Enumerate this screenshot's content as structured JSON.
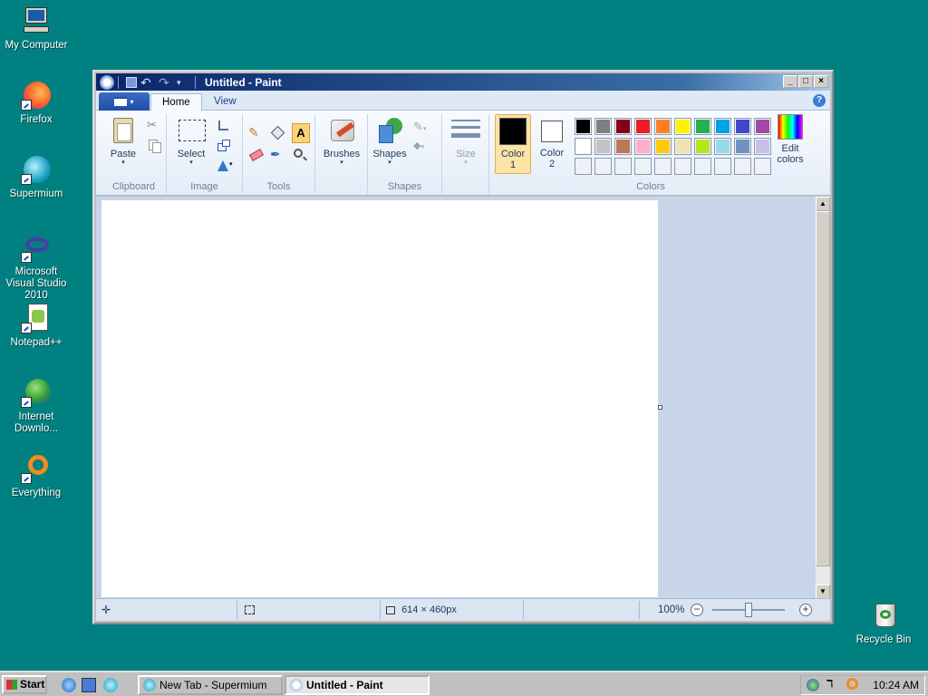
{
  "desktop": {
    "icons": [
      {
        "label": "My Computer"
      },
      {
        "label": "Firefox"
      },
      {
        "label": "Supermium"
      },
      {
        "label": "Microsoft Visual Studio 2010"
      },
      {
        "label": "Notepad++"
      },
      {
        "label": "Internet Downlo..."
      },
      {
        "label": "Everything"
      },
      {
        "label": "Recycle Bin"
      }
    ]
  },
  "window": {
    "title": "Untitled - Paint",
    "controls": {
      "minimize": "_",
      "maximize": "□",
      "close": "×"
    }
  },
  "ribbon": {
    "tabs": [
      {
        "label": "Home",
        "active": true
      },
      {
        "label": "View",
        "active": false
      }
    ],
    "groups": {
      "clipboard": {
        "label": "Clipboard",
        "paste": "Paste"
      },
      "image": {
        "label": "Image",
        "select": "Select"
      },
      "tools": {
        "label": "Tools"
      },
      "brushes": {
        "label": "Brushes"
      },
      "shapes": {
        "label": "Shapes",
        "shapes_btn": "Shapes"
      },
      "size": {
        "label": "Size"
      },
      "colors": {
        "label": "Colors",
        "color1": "Color\n1",
        "color1_a": "Color",
        "color1_b": "1",
        "color2_a": "Color",
        "color2_b": "2",
        "edit_a": "Edit",
        "edit_b": "colors",
        "color1_value": "#000000",
        "color2_value": "#ffffff",
        "palette_row1": [
          "#000000",
          "#7f7f7f",
          "#880015",
          "#ed1c24",
          "#ff7f27",
          "#fff200",
          "#22b14c",
          "#00a2e8",
          "#3f48cc",
          "#a349a4"
        ],
        "palette_row2": [
          "#ffffff",
          "#c3c3c3",
          "#b97a57",
          "#ffaec9",
          "#ffc90e",
          "#efe4b0",
          "#b5e61d",
          "#99d9ea",
          "#7092be",
          "#c8bfe7"
        ],
        "palette_row3": [
          "#eef2f8",
          "#eef2f8",
          "#eef2f8",
          "#eef2f8",
          "#eef2f8",
          "#eef2f8",
          "#eef2f8",
          "#eef2f8",
          "#eef2f8",
          "#eef2f8"
        ]
      }
    }
  },
  "statusbar": {
    "canvas_size": "614 × 460px",
    "zoom": "100%"
  },
  "taskbar": {
    "start": "Start",
    "tasks": [
      {
        "label": "New Tab - Supermium",
        "active": false
      },
      {
        "label": "Untitled - Paint",
        "active": true
      }
    ],
    "clock": "10:24 AM"
  }
}
